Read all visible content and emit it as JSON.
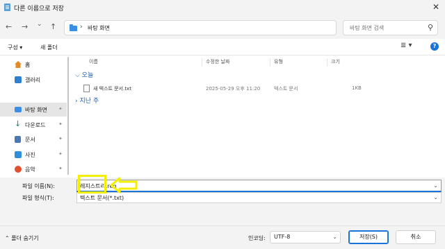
{
  "window": {
    "title": "다른 이름으로 저장",
    "close": "✕"
  },
  "nav": {
    "back": "←",
    "forward": "→",
    "recent": "⌄",
    "up": "↑"
  },
  "address": {
    "separator": "›",
    "crumb": "바탕 화면",
    "dropdown": "⌄",
    "refresh": "↻"
  },
  "search": {
    "placeholder": "바탕 화면 검색"
  },
  "toolbar": {
    "organize": "구성 ▾",
    "new_folder": "새 폴더",
    "view": "≣ ▾",
    "help": "?"
  },
  "sidebar": {
    "items": [
      {
        "label": "홈",
        "icon": "home-icon"
      },
      {
        "label": "갤러리",
        "icon": "gallery-icon"
      },
      {
        "label": "바탕 화면",
        "icon": "desktop-icon",
        "selected": true
      },
      {
        "label": "다운로드",
        "icon": "download-icon"
      },
      {
        "label": "문서",
        "icon": "documents-icon"
      },
      {
        "label": "사진",
        "icon": "pictures-icon"
      },
      {
        "label": "음악",
        "icon": "music-icon"
      }
    ],
    "pin": "📌"
  },
  "filelist": {
    "columns": [
      "이름",
      "수정한 날짜",
      "유형",
      "크기"
    ],
    "groups": [
      "⌵ 오늘",
      "› 지난 주"
    ],
    "files": [
      {
        "name": "새 텍스트 문서.txt",
        "modified": "2025-05-29 오후 11:20",
        "type": "텍스트 문서",
        "size": "1KB"
      }
    ]
  },
  "form": {
    "filename_label": "파일 이름(N):",
    "filename_value": "레지스트리.reg",
    "filetype_label": "파일 형식(T):",
    "filetype_value": "텍스트 문서(*.txt)",
    "dropdown": "⌄"
  },
  "bottom": {
    "hide_folders": "⌃ 폴더 숨기기",
    "encoding_label": "인코딩:",
    "encoding_value": "UTF-8",
    "save": "저장(S)",
    "cancel": "취소"
  },
  "colors": {
    "accent": "#1a73d9",
    "highlight": "#f4ef00",
    "group_text": "#1c5fb0"
  }
}
